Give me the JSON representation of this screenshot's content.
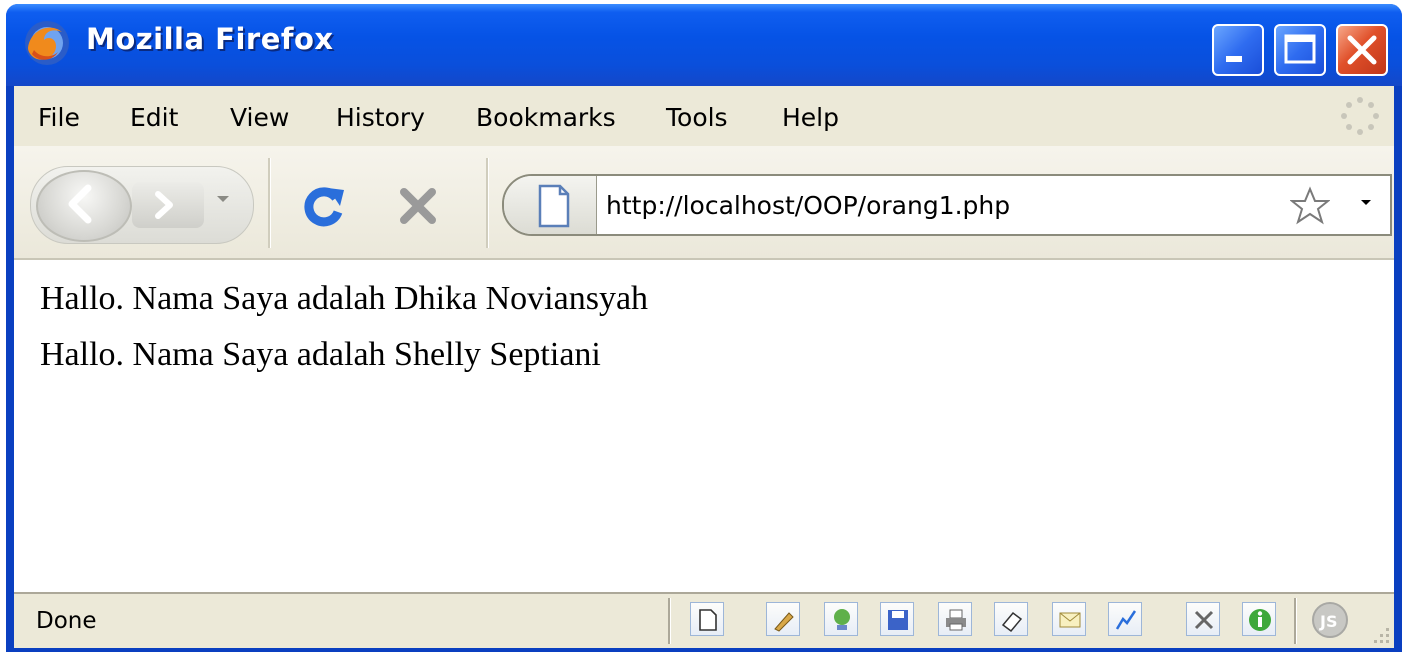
{
  "window": {
    "title": "Mozilla Firefox",
    "titlebar_color": "#0653e6"
  },
  "menu": {
    "items": [
      {
        "label": "File",
        "mnemonic": "F"
      },
      {
        "label": "Edit",
        "mnemonic": "E"
      },
      {
        "label": "View",
        "mnemonic": "V"
      },
      {
        "label": "History",
        "mnemonic": "s"
      },
      {
        "label": "Bookmarks",
        "mnemonic": "B"
      },
      {
        "label": "Tools",
        "mnemonic": "T"
      },
      {
        "label": "Help",
        "mnemonic": "H"
      }
    ]
  },
  "toolbar": {
    "back_icon": "back-arrow-icon",
    "forward_icon": "forward-arrow-icon",
    "reload_icon": "reload-icon",
    "stop_icon": "stop-icon",
    "reload_color": "#2a6edb",
    "stop_color": "#9a9a9a"
  },
  "addressbar": {
    "url": "http://localhost/OOP/orang1.php",
    "page_icon": "page-icon",
    "bookmark_icon": "star-icon"
  },
  "content": {
    "lines": [
      "Hallo. Nama Saya adalah Dhika Noviansyah",
      "Hallo. Nama Saya adalah Shelly Septiani"
    ]
  },
  "status": {
    "text": "Done",
    "icons": [
      "page-icon",
      "pencil-icon",
      "network-icon",
      "save-icon",
      "printer-icon",
      "eraser-icon",
      "envelope-icon",
      "graph-icon",
      "tools-icon",
      "info-icon",
      "js-icon"
    ]
  }
}
